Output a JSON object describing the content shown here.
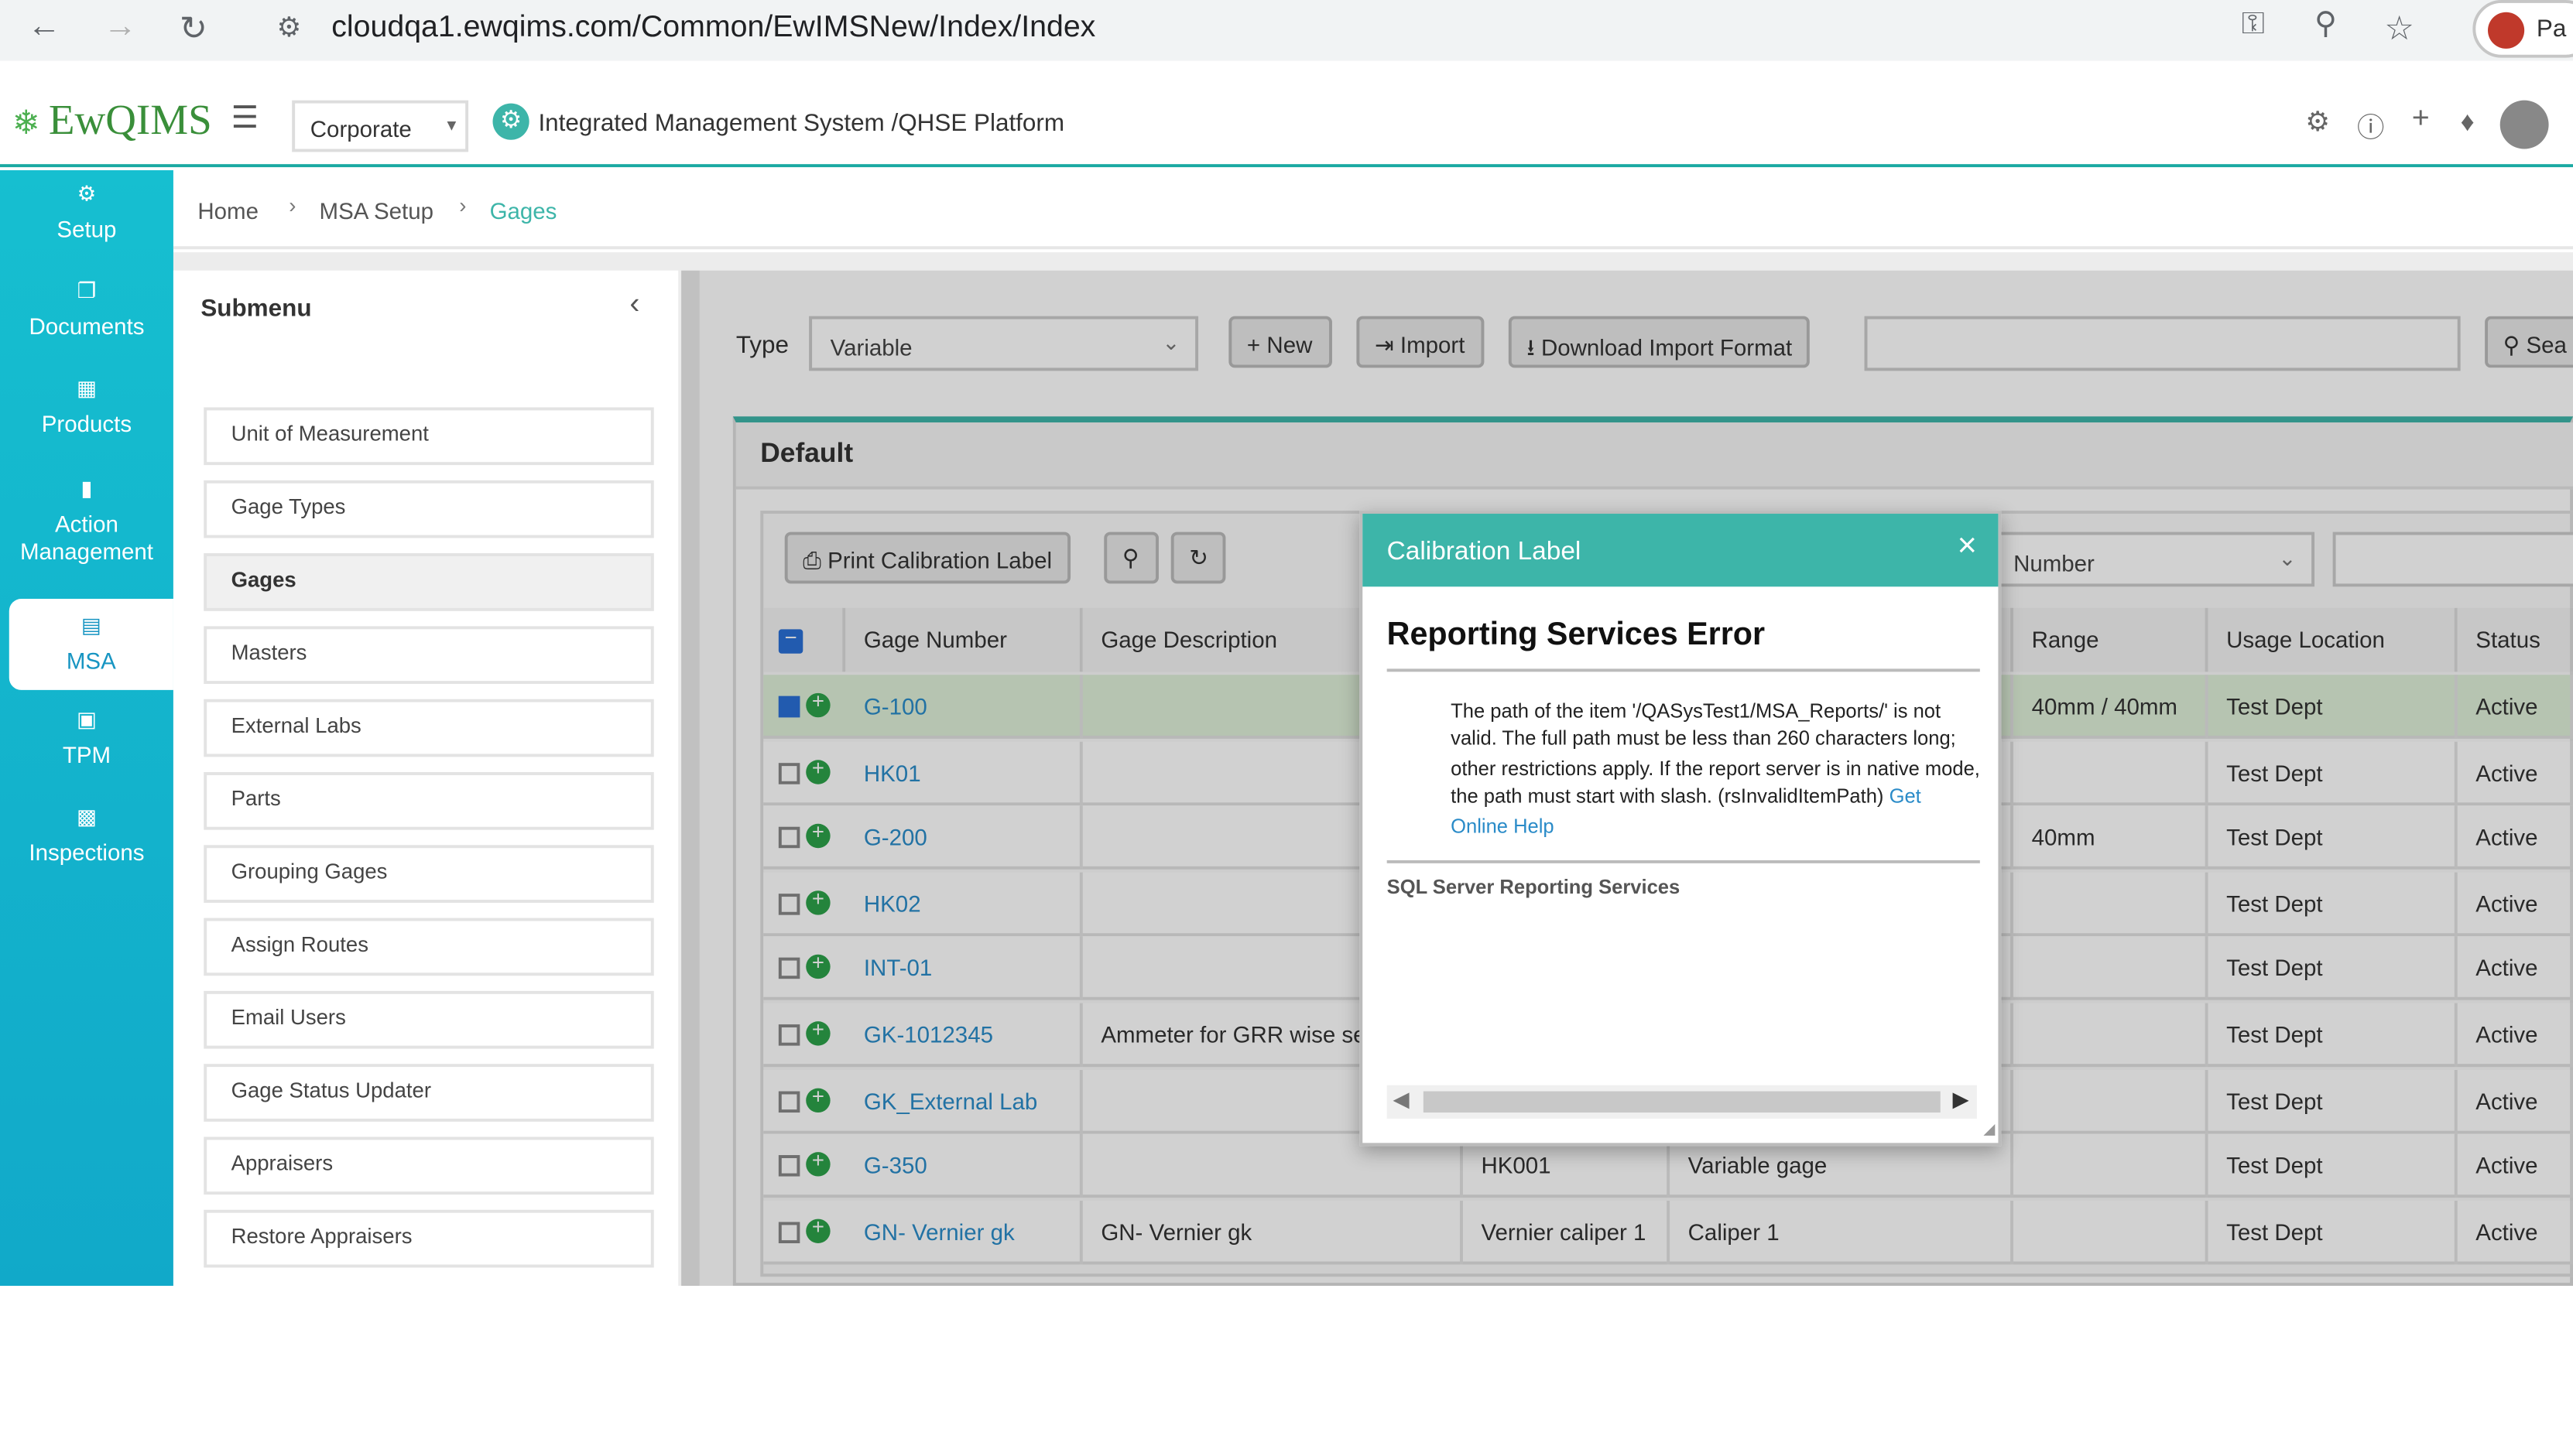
{
  "browser": {
    "url": "cloudqa1.ewqims.com/Common/EwIMSNew/Index/Index",
    "profile_label": "Pa"
  },
  "app": {
    "logo_text": "EwQIMS",
    "org_select": "Corporate",
    "platform_title": "Integrated Management System /QHSE Platform"
  },
  "sidebar": {
    "items": [
      {
        "label": "Setup",
        "icon": "cogs-icon"
      },
      {
        "label": "Documents",
        "icon": "documents-icon"
      },
      {
        "label": "Products",
        "icon": "products-icon"
      },
      {
        "label": "Action Management",
        "icon": "action-icon"
      },
      {
        "label": "MSA",
        "icon": "chart-icon"
      },
      {
        "label": "TPM",
        "icon": "tpm-icon"
      },
      {
        "label": "Inspections",
        "icon": "inspections-icon"
      }
    ],
    "active": "MSA"
  },
  "breadcrumb": {
    "home": "Home",
    "parent": "MSA Setup",
    "current": "Gages"
  },
  "submenu": {
    "title": "Submenu",
    "items": [
      "Unit of Measurement",
      "Gage Types",
      "Gages",
      "Masters",
      "External Labs",
      "Parts",
      "Grouping Gages",
      "Assign Routes",
      "Email Users",
      "Gage Status Updater",
      "Appraisers",
      "Restore Appraisers"
    ],
    "selected": "Gages"
  },
  "toolbar": {
    "type_label": "Type",
    "type_value": "Variable",
    "new_label": "New",
    "import_label": "Import",
    "download_label": "Download Import Format",
    "search_label": "Sea"
  },
  "panel": {
    "title": "Default",
    "print_label": "Print Calibration Label",
    "filter_select": "Number"
  },
  "table": {
    "columns": [
      "Gage Number",
      "Gage Description",
      "",
      "",
      "Range",
      "Usage Location",
      "Status"
    ],
    "rows": [
      {
        "number": "G-100",
        "description": "",
        "c3": "",
        "c4": "",
        "range": "40mm / 40mm",
        "location": "Test Dept",
        "status": "Active",
        "checked": true
      },
      {
        "number": "HK01",
        "description": "",
        "c3": "",
        "c4": "",
        "range": "",
        "location": "Test Dept",
        "status": "Active",
        "checked": false
      },
      {
        "number": "G-200",
        "description": "",
        "c3": "",
        "c4": "",
        "range": "40mm",
        "location": "Test Dept",
        "status": "Active",
        "checked": false
      },
      {
        "number": "HK02",
        "description": "",
        "c3": "",
        "c4": "",
        "range": "",
        "location": "Test Dept",
        "status": "Active",
        "checked": false
      },
      {
        "number": "INT-01",
        "description": "",
        "c3": "",
        "c4": "",
        "range": "",
        "location": "Test Dept",
        "status": "Active",
        "checked": false
      },
      {
        "number": "GK-1012345",
        "description": "Ammeter for GRR wise se",
        "c3": "",
        "c4": "",
        "range": "",
        "location": "Test Dept",
        "status": "Active",
        "checked": false
      },
      {
        "number": "GK_External Lab",
        "description": "",
        "c3": "",
        "c4": "",
        "range": "",
        "location": "Test Dept",
        "status": "Active",
        "checked": false
      },
      {
        "number": "G-350",
        "description": "",
        "c3": "HK001",
        "c4": "Variable gage",
        "range": "",
        "location": "Test Dept",
        "status": "Active",
        "checked": false
      },
      {
        "number": "GN- Vernier gk",
        "description": "GN- Vernier gk",
        "c3": "Vernier caliper 1",
        "c4": "Caliper 1",
        "range": "",
        "location": "Test Dept",
        "status": "Active",
        "checked": false
      }
    ]
  },
  "modal": {
    "title": "Calibration Label",
    "error_heading": "Reporting Services Error",
    "error_text": "The path of the item '/QASysTest1/MSA_Reports/' is not valid. The full path must be less than 260 characters long; other restrictions apply. If the report server is in native mode, the path must start with slash. (rsInvalidItemPath)",
    "help_link": "Get Online Help",
    "footer": "SQL Server Reporting Services"
  },
  "colors": {
    "accent": "#3db5a9",
    "sidebar": "#16bfd0",
    "link": "#2a8bc8",
    "selected_row": "#dff0d8"
  }
}
